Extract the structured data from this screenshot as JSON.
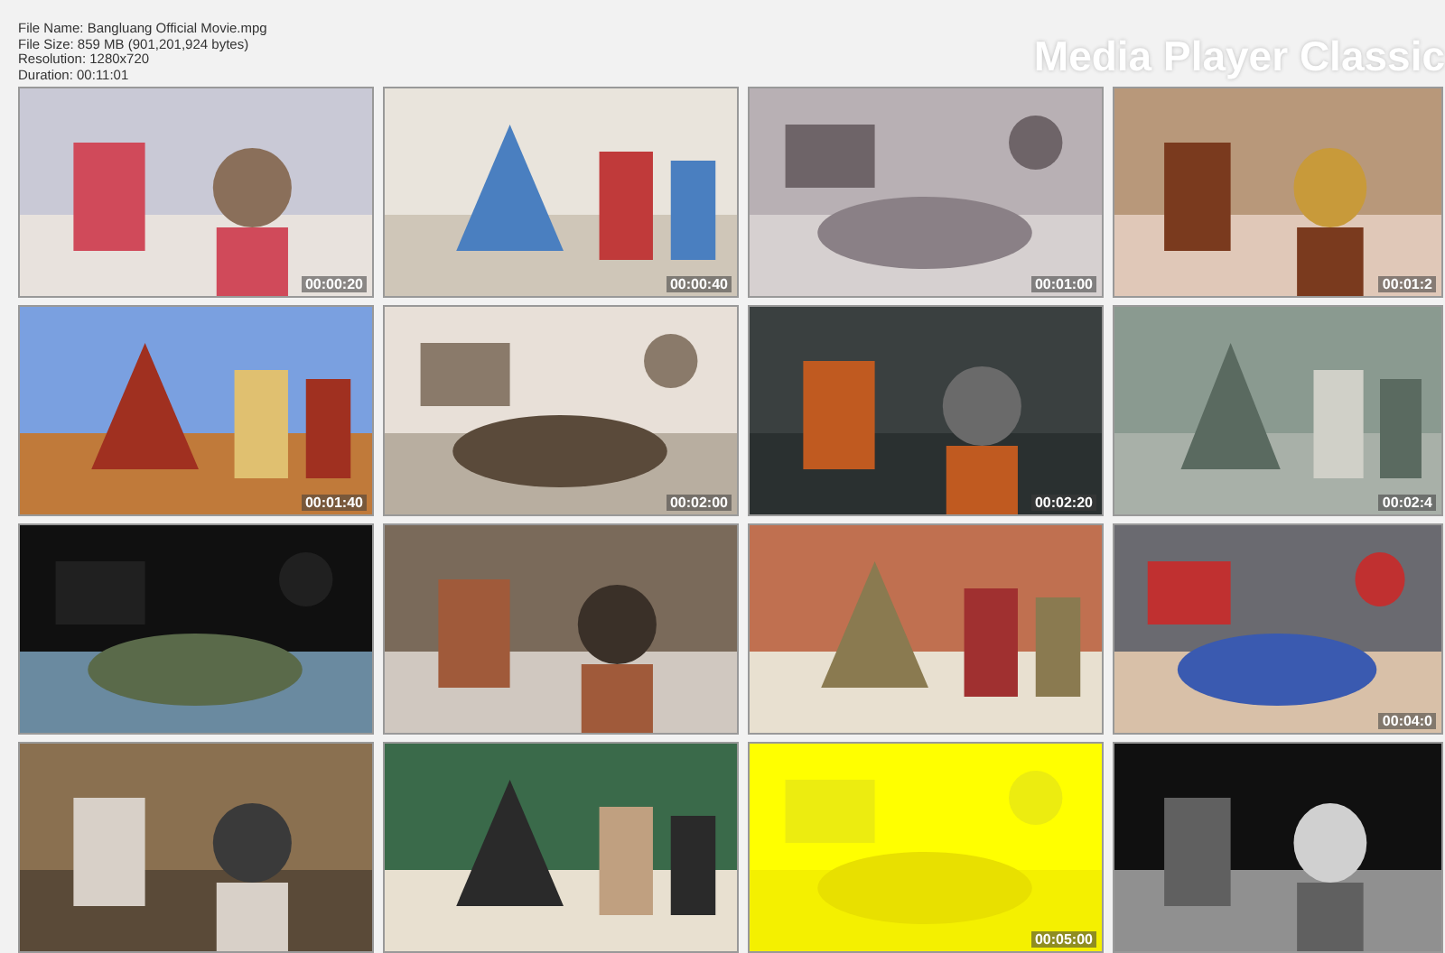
{
  "file_info": [
    "File Name: Bangluang Official Movie.mpg",
    "File Size: 859 MB (901,201,924 bytes)",
    "Resolution: 1280x720",
    "Duration: 00:11:01"
  ],
  "brand": "Media Player Classic",
  "thumbnails": [
    {
      "kind": "picture",
      "timestamp": "00:00:20"
    },
    {
      "kind": "picture",
      "timestamp": "00:00:40"
    },
    {
      "kind": "picture",
      "timestamp": "00:01:00"
    },
    {
      "kind": "picture",
      "timestamp": "00:01:2"
    },
    {
      "kind": "picture",
      "timestamp": "00:01:40"
    },
    {
      "kind": "picture",
      "timestamp": "00:02:00"
    },
    {
      "kind": "picture",
      "timestamp": "00:02:20"
    },
    {
      "kind": "picture",
      "timestamp": "00:02:4"
    },
    {
      "kind": "picture"
    },
    {
      "kind": "picture"
    },
    {
      "kind": "picture"
    },
    {
      "kind": "picture",
      "timestamp": "00:04:0"
    },
    {
      "kind": "picture"
    },
    {
      "kind": "picture"
    },
    {
      "kind": "picture",
      "timestamp": "00:05:00"
    },
    {
      "kind": "picture"
    }
  ]
}
